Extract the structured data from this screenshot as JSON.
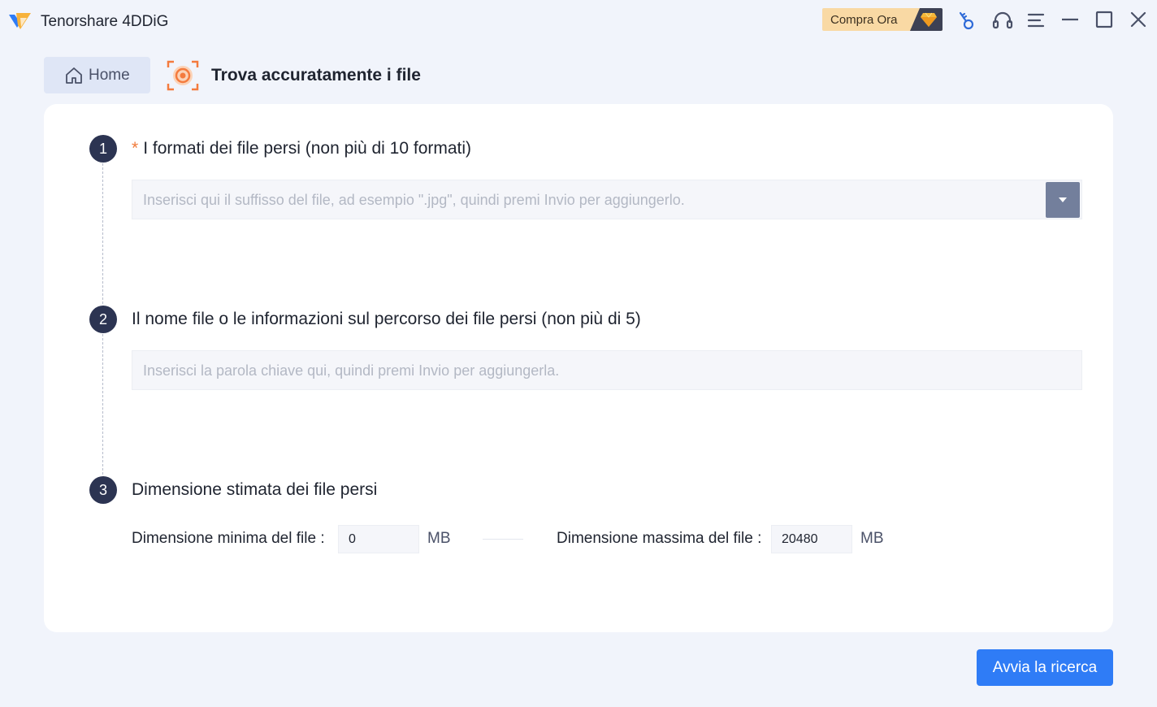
{
  "app": {
    "title": "Tenorshare 4DDiG"
  },
  "titlebar": {
    "buy_label": "Compra Ora",
    "icons": [
      "key-icon",
      "headset-icon",
      "menu-icon",
      "minimize-icon",
      "maximize-icon",
      "close-icon"
    ]
  },
  "header": {
    "home_label": "Home",
    "page_title": "Trova accuratamente i file"
  },
  "steps": [
    {
      "number": "1",
      "required_mark": "*",
      "title": "I formati dei file persi (non più di 10 formati)",
      "placeholder": "Inserisci qui il suffisso del file, ad esempio \".jpg\", quindi premi Invio per aggiungerlo."
    },
    {
      "number": "2",
      "title": "Il nome file o le informazioni sul percorso dei file persi (non più di 5)",
      "placeholder": "Inserisci la parola chiave qui, quindi premi Invio per aggiungerla."
    },
    {
      "number": "3",
      "title": "Dimensione stimata dei file persi"
    }
  ],
  "size": {
    "min_label": "Dimensione minima del file :",
    "min_value": "0",
    "max_label": "Dimensione massima del file :",
    "max_value": "20480",
    "unit": "MB"
  },
  "actions": {
    "start_label": "Avvia la ricerca"
  },
  "colors": {
    "accent": "#2f7cf6",
    "step_badge": "#2c3452",
    "buy_bg": "#f9d9a4",
    "required": "#f07a3a"
  }
}
